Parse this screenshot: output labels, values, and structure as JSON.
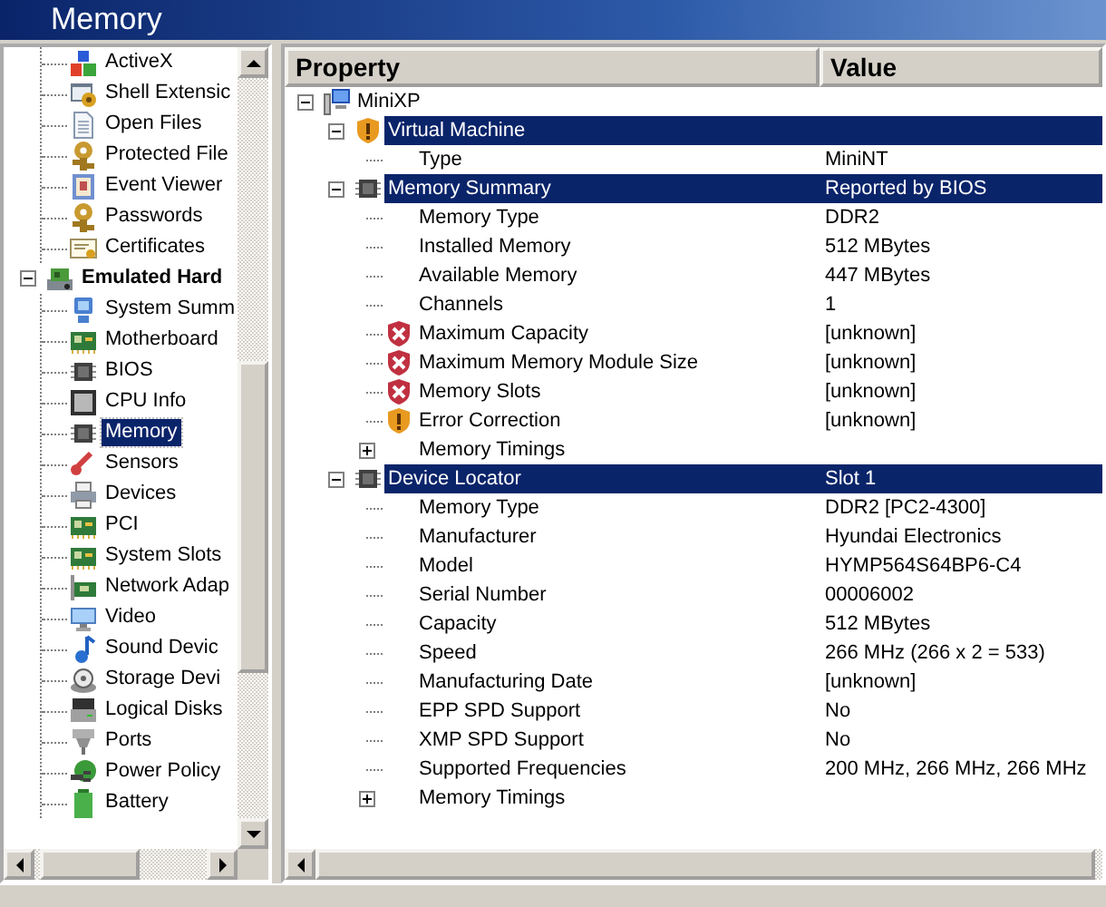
{
  "window": {
    "title": "Memory"
  },
  "sidebar": {
    "continued_items": [
      {
        "label": "ActiveX",
        "selected": false
      },
      {
        "label": "Shell Extensic",
        "selected": false
      },
      {
        "label": "Open Files",
        "selected": false
      },
      {
        "label": "Protected File",
        "selected": false
      },
      {
        "label": "Event Viewer",
        "selected": false
      },
      {
        "label": "Passwords",
        "selected": false
      },
      {
        "label": "Certificates",
        "selected": false
      }
    ],
    "nodes": [
      {
        "label": "Emulated Hard",
        "selected": false,
        "expanded": true,
        "children": [
          {
            "label": "System Summ",
            "selected": false
          },
          {
            "label": "Motherboard",
            "selected": false
          },
          {
            "label": "BIOS",
            "selected": false
          },
          {
            "label": "CPU Info",
            "selected": false
          },
          {
            "label": "Memory",
            "selected": true
          },
          {
            "label": "Sensors",
            "selected": false
          },
          {
            "label": "Devices",
            "selected": false
          },
          {
            "label": "PCI",
            "selected": false
          },
          {
            "label": "System Slots",
            "selected": false
          },
          {
            "label": "Network Adap",
            "selected": false
          },
          {
            "label": "Video",
            "selected": false
          },
          {
            "label": "Sound Devic",
            "selected": false
          },
          {
            "label": "Storage Devi",
            "selected": false
          },
          {
            "label": "Logical Disks",
            "selected": false
          },
          {
            "label": "Ports",
            "selected": false
          },
          {
            "label": "Power Policy",
            "selected": false
          },
          {
            "label": "Battery",
            "selected": false
          }
        ]
      }
    ]
  },
  "properties": {
    "columns": [
      "Property",
      "Value"
    ],
    "tree": [
      {
        "label": "MiniXP",
        "kind": "root",
        "expanded": true,
        "children": [
          {
            "label": "Virtual Machine",
            "kind": "section",
            "warning": true,
            "error": false,
            "expanded": true,
            "children": [
              {
                "label": "Type",
                "value": "MiniNT",
                "kind": "property",
                "warning": false,
                "error": false
              }
            ]
          },
          {
            "label": "Memory Summary",
            "value": "Reported by BIOS",
            "kind": "section",
            "warning": false,
            "error": false,
            "expanded": true,
            "children": [
              {
                "label": "Memory Type",
                "value": "DDR2",
                "kind": "property",
                "warning": false,
                "error": false
              },
              {
                "label": "Installed Memory",
                "value": "512 MBytes",
                "kind": "property",
                "warning": false,
                "error": false
              },
              {
                "label": "Available Memory",
                "value": "447 MBytes",
                "kind": "property",
                "warning": false,
                "error": false
              },
              {
                "label": "Channels",
                "value": "1",
                "kind": "property",
                "warning": false,
                "error": false
              },
              {
                "label": "Maximum Capacity",
                "value": "[unknown]",
                "kind": "property",
                "warning": false,
                "error": true
              },
              {
                "label": "Maximum Memory Module Size",
                "value": "[unknown]",
                "kind": "property",
                "warning": false,
                "error": true
              },
              {
                "label": "Memory Slots",
                "value": "[unknown]",
                "kind": "property",
                "warning": false,
                "error": true
              },
              {
                "label": "Error Correction",
                "value": "[unknown]",
                "kind": "property",
                "warning": true,
                "error": false
              },
              {
                "label": "Memory Timings",
                "kind": "group",
                "expanded": false
              }
            ]
          },
          {
            "label": "Device Locator",
            "value": "Slot 1",
            "kind": "section",
            "warning": false,
            "error": false,
            "expanded": true,
            "children": [
              {
                "label": "Memory Type",
                "value": "DDR2 [PC2-4300]",
                "kind": "property",
                "warning": false,
                "error": false
              },
              {
                "label": "Manufacturer",
                "value": "Hyundai Electronics",
                "kind": "property",
                "warning": false,
                "error": false
              },
              {
                "label": "Model",
                "value": "HYMP564S64BP6-C4",
                "kind": "property",
                "warning": false,
                "error": false
              },
              {
                "label": "Serial Number",
                "value": "00006002",
                "kind": "property",
                "warning": false,
                "error": false
              },
              {
                "label": "Capacity",
                "value": "512 MBytes",
                "kind": "property",
                "warning": false,
                "error": false
              },
              {
                "label": "Speed",
                "value": "266 MHz (266 x 2 = 533)",
                "kind": "property",
                "warning": false,
                "error": false
              },
              {
                "label": "Manufacturing Date",
                "value": "[unknown]",
                "kind": "property",
                "warning": false,
                "error": false
              },
              {
                "label": "EPP SPD Support",
                "value": "No",
                "kind": "property",
                "warning": false,
                "error": false
              },
              {
                "label": "XMP SPD Support",
                "value": "No",
                "kind": "property",
                "warning": false,
                "error": false
              },
              {
                "label": "Supported Frequencies",
                "value": "200 MHz, 266 MHz, 266 MHz",
                "kind": "property",
                "warning": false,
                "error": false
              },
              {
                "label": "Memory Timings",
                "kind": "group",
                "expanded": false
              }
            ]
          }
        ]
      }
    ]
  }
}
